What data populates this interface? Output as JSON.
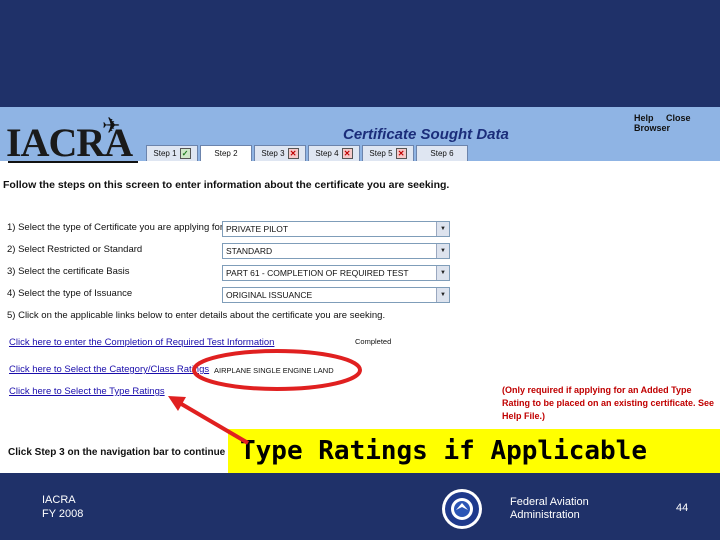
{
  "app": {
    "logo_text": "IACRA",
    "title": "Certificate Sought Data",
    "links": [
      "Help",
      "Close Browser"
    ]
  },
  "steps": [
    {
      "label": "Step 1",
      "status": "complete",
      "symbol": "✓"
    },
    {
      "label": "Step 2",
      "status": "current",
      "symbol": ""
    },
    {
      "label": "Step 3",
      "status": "incomplete",
      "symbol": "✕"
    },
    {
      "label": "Step 4",
      "status": "incomplete",
      "symbol": "✕"
    },
    {
      "label": "Step 5",
      "status": "incomplete",
      "symbol": "✕"
    },
    {
      "label": "Step 6",
      "status": "none",
      "symbol": ""
    }
  ],
  "instruction": "Follow the steps on this screen to enter information about the certificate you are seeking.",
  "fields": [
    {
      "label": "1) Select the type of Certificate you are applying for",
      "value": "PRIVATE PILOT"
    },
    {
      "label": "2) Select Restricted or Standard",
      "value": "STANDARD"
    },
    {
      "label": "3) Select the certificate Basis",
      "value": "PART 61 - COMPLETION OF REQUIRED TEST"
    },
    {
      "label": "4) Select the type of Issuance",
      "value": "ORIGINAL ISSUANCE"
    }
  ],
  "step5_text": "5) Click on the applicable links below to enter details about the certificate you are seeking.",
  "links": {
    "required_test": "Click here to enter the Completion of Required Test Information",
    "required_test_status": "Completed",
    "category_class": "Click here to Select the Category/Class Ratings",
    "category_class_value": "AIRPLANE SINGLE ENGINE LAND",
    "type_ratings": "Click here to Select the Type Ratings"
  },
  "note": "(Only required if applying for an Added Type Rating to be placed on an existing certificate. See Help File.)",
  "bottom_instruction": "Click Step 3 on the navigation bar to continue",
  "callout": "Type Ratings if Applicable",
  "footer": {
    "org": "IACRA",
    "year": "FY 2008",
    "agency_line1": "Federal Aviation",
    "agency_line2": "Administration",
    "page": "44"
  },
  "colors": {
    "slide_bg": "#1f3169",
    "header_bg": "#8fb4e4",
    "callout_bg": "#ffff00",
    "annotation": "#e02020",
    "note_red": "#c00000"
  }
}
